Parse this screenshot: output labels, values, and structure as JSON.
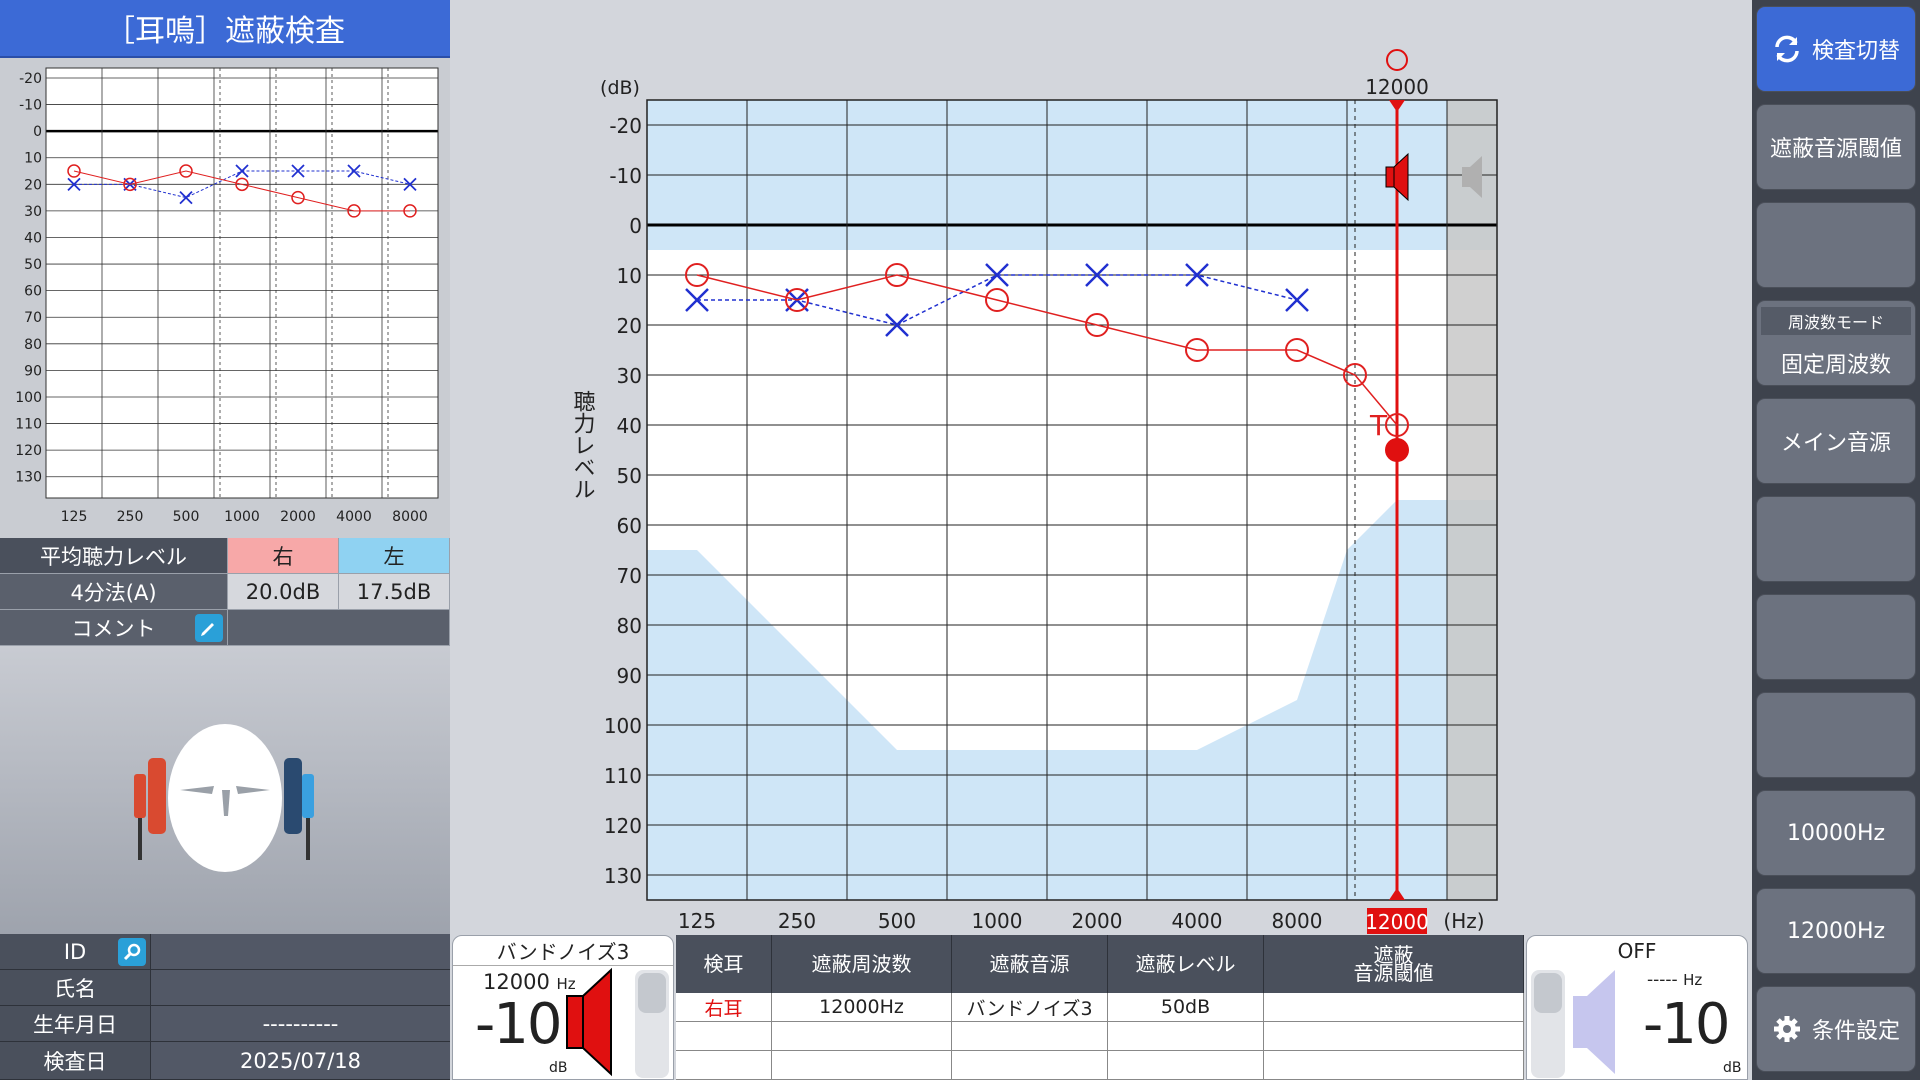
{
  "title": "［耳鳴］遮蔽検査",
  "mini_chart": {
    "y_ticks": [
      "-20",
      "-10",
      "0",
      "10",
      "20",
      "30",
      "40",
      "50",
      "60",
      "70",
      "80",
      "90",
      "100",
      "110",
      "120",
      "130"
    ],
    "x_ticks": [
      "125",
      "250",
      "500",
      "1000",
      "2000",
      "4000",
      "8000"
    ],
    "right": [
      15,
      20,
      15,
      20,
      25,
      30,
      30
    ],
    "left": [
      20,
      20,
      25,
      15,
      15,
      15,
      20
    ]
  },
  "average": {
    "header_label": "平均聴力レベル",
    "right_label": "右",
    "left_label": "左",
    "method_label": "4分法(A)",
    "right_value": "20.0dB",
    "left_value": "17.5dB",
    "comment_label": "コメント"
  },
  "patient": {
    "id_label": "ID",
    "name_label": "氏名",
    "birth_label": "生年月日",
    "birth_value": "----------",
    "date_label": "検査日",
    "date_value": "2025/07/18"
  },
  "chart_data": {
    "type": "scatter",
    "ylabel": "聴力レベル",
    "y_unit": "(dB)",
    "x_unit": "(Hz)",
    "y_ticks": [
      "-20",
      "-10",
      "0",
      "10",
      "20",
      "30",
      "40",
      "50",
      "60",
      "70",
      "80",
      "90",
      "100",
      "110",
      "120",
      "130"
    ],
    "x_ticks": [
      "125",
      "250",
      "500",
      "1000",
      "2000",
      "4000",
      "8000"
    ],
    "ylim": [
      -20,
      130
    ],
    "selected_freq": "12000",
    "series": [
      {
        "name": "右",
        "marker": "circle",
        "color": "#e02020",
        "x": [
          125,
          250,
          500,
          1000,
          2000,
          4000,
          8000,
          10000,
          12000
        ],
        "y": [
          15,
          20,
          15,
          20,
          25,
          30,
          30,
          35,
          45
        ]
      },
      {
        "name": "左",
        "marker": "cross",
        "color": "#2030d0",
        "x": [
          125,
          250,
          500,
          1000,
          2000,
          4000,
          8000
        ],
        "y": [
          20,
          20,
          25,
          15,
          15,
          15,
          20
        ]
      }
    ],
    "tinnitus_label": "T",
    "masking_point": {
      "x": 12000,
      "y": 50
    }
  },
  "left_gauge": {
    "title": "バンドノイズ3",
    "freq": "12000",
    "freq_unit": "Hz",
    "level": "-10",
    "unit": "dB"
  },
  "right_gauge": {
    "title": "OFF",
    "freq": "-----",
    "freq_unit": "Hz",
    "level": "-10",
    "unit": "dB"
  },
  "table": {
    "headers": [
      "検耳",
      "遮蔽周波数",
      "遮蔽音源",
      "遮蔽レベル",
      "遮蔽\n音源閾値"
    ],
    "row": [
      "右耳",
      "12000Hz",
      "バンドノイズ3",
      "50dB",
      ""
    ]
  },
  "sidebar": {
    "switch": "検査切替",
    "threshold": "遮蔽音源閾値",
    "mode_caption": "周波数モード",
    "mode": "固定周波数",
    "main_source": "メイン音源",
    "f10000": "10000Hz",
    "f12000": "12000Hz",
    "settings": "条件設定"
  },
  "colors": {
    "right": "#e02020",
    "left": "#2030d0",
    "accent": "#3c6ad6",
    "shade": "#cfe6f7"
  }
}
